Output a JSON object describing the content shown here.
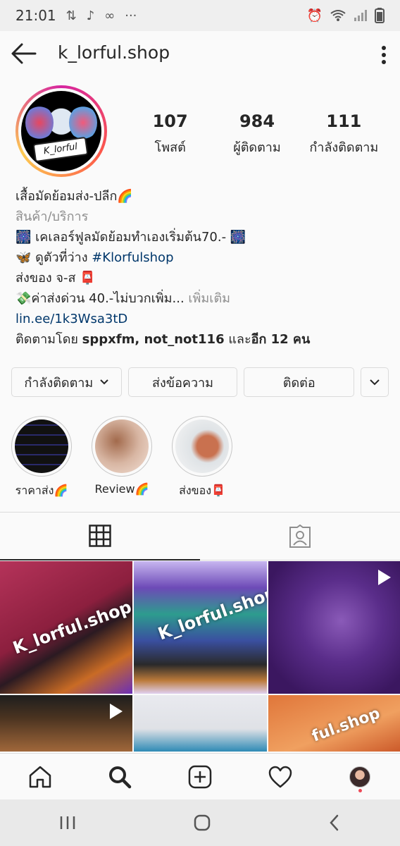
{
  "statusbar": {
    "time": "21:01"
  },
  "header": {
    "username": "k_lorful.shop"
  },
  "avatar": {
    "badge_text": "K_lorful"
  },
  "stats": [
    {
      "num": "107",
      "label": "โพสต์"
    },
    {
      "num": "984",
      "label": "ผู้ติดตาม"
    },
    {
      "num": "111",
      "label": "กำลังติดตาม"
    }
  ],
  "bio": {
    "name": "เสื้อมัดย้อมส่ง-ปลีก🌈",
    "category": "สินค้า/บริการ",
    "line1": "🎆 เคเลอร์ฟูลมัดย้อมทำเองเริ่มต้น70.- 🎆",
    "line2_prefix": "🦋 ดูตัวที่ว่าง ",
    "line2_tag": "#Klorfulshop",
    "line3": "ส่งของ จ-ส 📮",
    "line4": "💸ค่าส่งด่วน 40.-ไม่บวกเพิ่ม...",
    "line4_more": " เพิ่มเติม",
    "link": "lin.ee/1k3Wsa3tD",
    "followed_prefix": "ติดตามโดย ",
    "followed_names": "sppxfm, not_not116",
    "followed_mid": " และ",
    "followed_count": "อีก 12 คน"
  },
  "buttons": {
    "following": "กำลังติดตาม",
    "message": "ส่งข้อความ",
    "contact": "ติดต่อ"
  },
  "highlights": [
    {
      "label": "ราคาส่ง🌈"
    },
    {
      "label": "Review🌈"
    },
    {
      "label": "ส่งของ📮"
    }
  ],
  "posts": {
    "watermark": "K_lorful.shop",
    "watermark2": "K_lorful.shop",
    "watermark3": "ful.shop"
  },
  "colors": {
    "link": "#00376b",
    "secondary": "#8e8e8e",
    "notification_dot": "#ed4956"
  }
}
